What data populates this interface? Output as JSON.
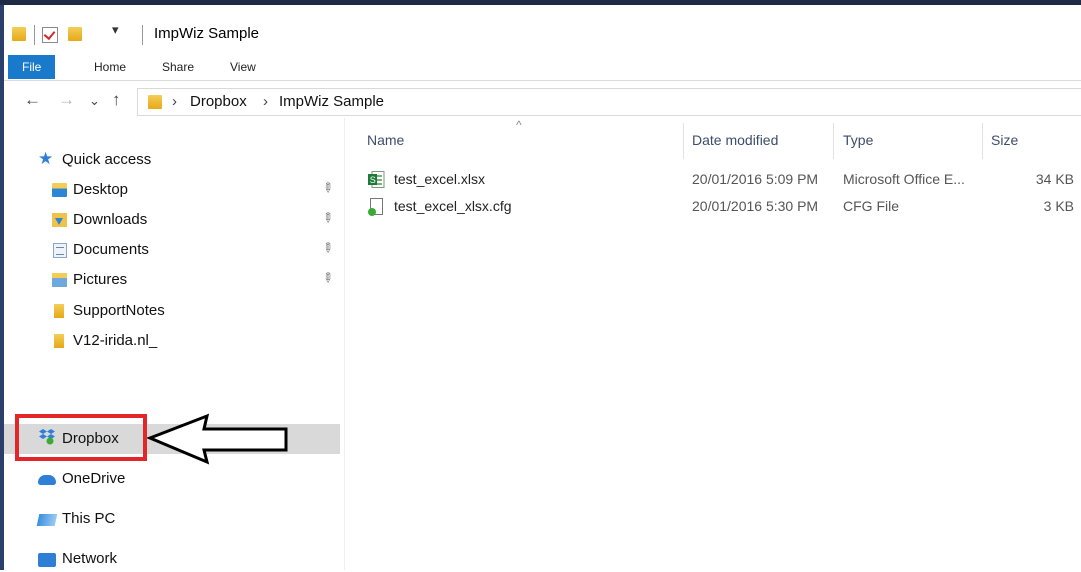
{
  "window": {
    "title": "ImpWiz Sample"
  },
  "ribbon": {
    "tabs": [
      "File",
      "Home",
      "Share",
      "View"
    ]
  },
  "address": {
    "crumbs": [
      "Dropbox",
      "ImpWiz Sample"
    ]
  },
  "nav_pane": {
    "quick_access": "Quick access",
    "pinned": [
      "Desktop",
      "Downloads",
      "Documents",
      "Pictures"
    ],
    "folders": [
      "SupportNotes",
      "V12-irida.nl_"
    ],
    "locations": [
      "Dropbox",
      "OneDrive",
      "This PC",
      "Network"
    ],
    "selected": "Dropbox"
  },
  "file_list": {
    "columns": [
      "Name",
      "Date modified",
      "Type",
      "Size"
    ],
    "rows": [
      {
        "name": "test_excel.xlsx",
        "date": "20/01/2016 5:09 PM",
        "type": "Microsoft Office E...",
        "size": "34 KB",
        "icon": "excel-file-icon"
      },
      {
        "name": "test_excel_xlsx.cfg",
        "date": "20/01/2016 5:30 PM",
        "type": "CFG File",
        "size": "3 KB",
        "icon": "cfg-file-icon"
      }
    ]
  },
  "colors": {
    "file_tab": "#1979ca",
    "highlight": "#e3262a",
    "selection": "#d9d9d9"
  }
}
